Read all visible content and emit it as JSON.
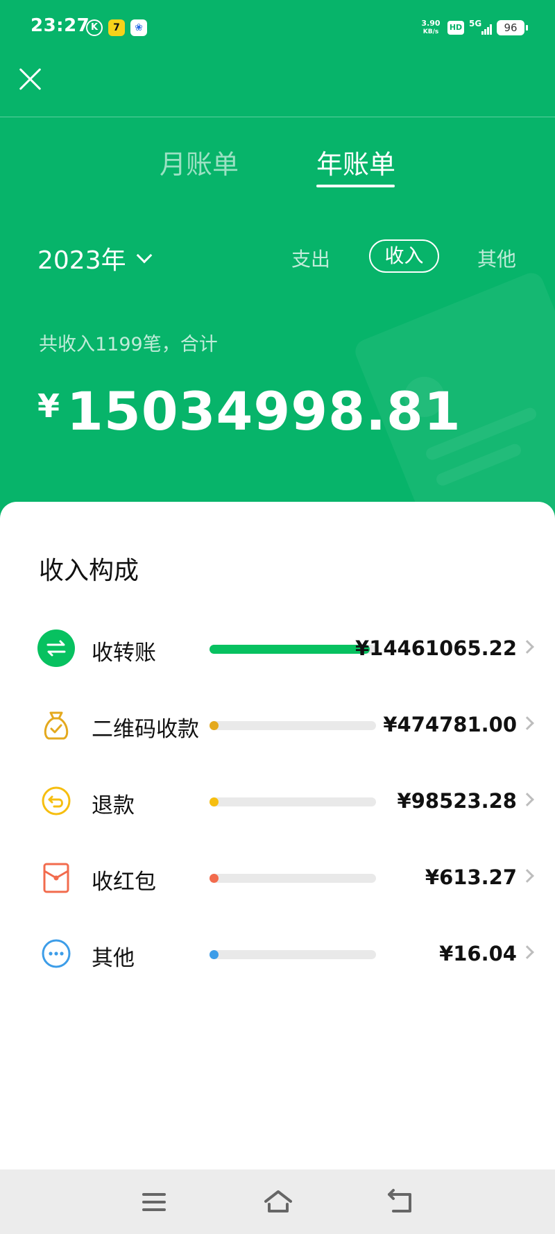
{
  "status_bar": {
    "time": "23:27",
    "app_icons": [
      "k-icon",
      "app-7-icon",
      "baidu-icon"
    ],
    "k_glyph": "K",
    "seven_glyph": "7",
    "baidu_glyph": "❀",
    "net_speed": "3.90",
    "net_unit": "KB/s",
    "hd": "HD",
    "network": "5G",
    "battery": "96"
  },
  "header": {
    "tabs": [
      {
        "label": "月账单",
        "active": false
      },
      {
        "label": "年账单",
        "active": true
      }
    ]
  },
  "filters": {
    "year": "2023年",
    "options": [
      {
        "label": "支出",
        "selected": false
      },
      {
        "label": "收入",
        "selected": true
      },
      {
        "label": "其他",
        "selected": false
      }
    ]
  },
  "summary": {
    "text": "共收入1199笔，合计",
    "currency": "¥",
    "amount": "15034998.81"
  },
  "breakdown": {
    "title": "收入构成",
    "items": [
      {
        "label": "收转账",
        "amount": "¥14461065.22",
        "share": 0.9618,
        "color": "#07c160",
        "icon": "transfer-icon"
      },
      {
        "label": "二维码收款",
        "amount": "¥474781.00",
        "share": 0.0316,
        "color": "#e4a91e",
        "icon": "money-bag-icon"
      },
      {
        "label": "退款",
        "amount": "¥98523.28",
        "share": 0.0066,
        "color": "#f6be10",
        "icon": "refund-icon"
      },
      {
        "label": "收红包",
        "amount": "¥613.27",
        "share": 0.0001,
        "color": "#f26b4d",
        "icon": "red-packet-icon"
      },
      {
        "label": "其他",
        "amount": "¥16.04",
        "share": 0.0,
        "color": "#3d9de8",
        "icon": "more-icon"
      }
    ]
  },
  "colors": {
    "brand_green": "#07b46a",
    "card": "#ffffff"
  }
}
